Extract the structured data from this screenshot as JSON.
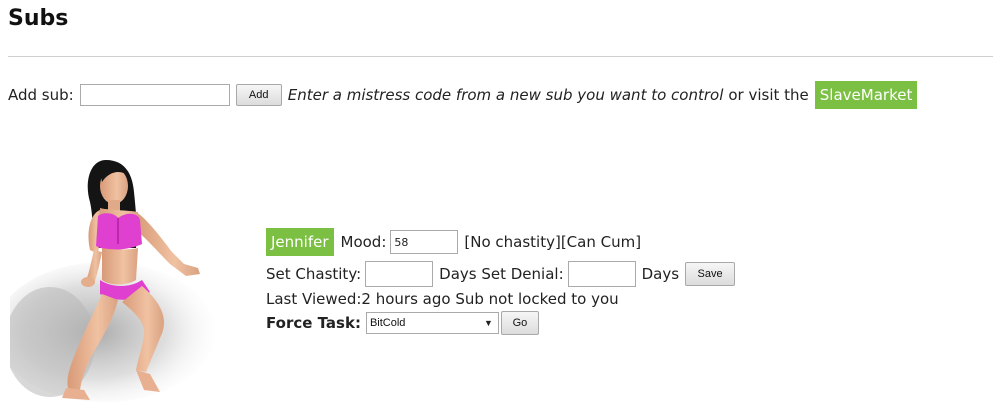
{
  "page": {
    "title": "Subs"
  },
  "add_sub": {
    "label": "Add sub:",
    "input_value": "",
    "button_label": "Add",
    "hint": "Enter a mistress code from a new sub you want to control",
    "connector": "or visit the",
    "market_link": "SlaveMarket"
  },
  "sub": {
    "name": "Jennifer",
    "mood_label": "Mood:",
    "mood_value": "58",
    "status": "[No chastity][Can Cum]",
    "set_chastity_label": "Set Chastity:",
    "chastity_value": "",
    "days_set_denial_label": "Days Set Denial:",
    "denial_value": "",
    "days_label": "Days",
    "save_label": "Save",
    "last_viewed": "Last Viewed:2 hours ago Sub not locked to you",
    "force_task_label": "Force Task:",
    "force_task_selected": "BitCold",
    "go_label": "Go",
    "image_icon": "sub-avatar-figure"
  },
  "colors": {
    "accent_green": "#7bc043",
    "divider": "#cfcfcf",
    "outfit_pink": "#e040d0"
  }
}
